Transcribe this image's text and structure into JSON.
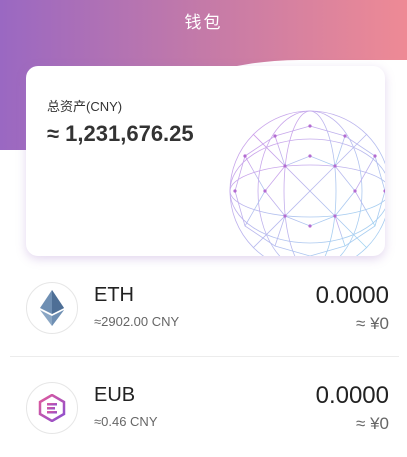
{
  "header": {
    "title": "钱包"
  },
  "assets": {
    "label": "总资产(CNY)",
    "total": "≈ 1,231,676.25"
  },
  "tokens": [
    {
      "symbol": "ETH",
      "price": "≈2902.00 CNY",
      "balance": "0.0000",
      "value": "≈ ¥0",
      "icon": "ethereum-icon"
    },
    {
      "symbol": "EUB",
      "price": "≈0.46 CNY",
      "balance": "0.0000",
      "value": "≈ ¥0",
      "icon": "eub-icon"
    }
  ],
  "colors": {
    "gradient_start": "#9a68c2",
    "gradient_end": "#ee8a95",
    "accent": "#b36bd1"
  }
}
